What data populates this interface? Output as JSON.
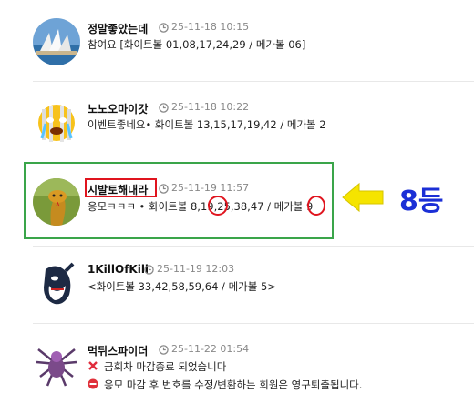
{
  "comments": [
    {
      "nick": "정말좋았는데",
      "time": "25-11-18 10:15",
      "text": "참여요 [화이트볼 01,08,17,24,29 / 메가볼 06]",
      "avatar": "opera-house-photo-avatar"
    },
    {
      "nick": "노노오마이갓",
      "time": "25-11-18 10:22",
      "text": "이벤트좋네요• 화이트볼 13,15,17,19,42 / 메가볼 2",
      "avatar": "crying-emoji-avatar"
    },
    {
      "nick": "시발토해내라",
      "time": "25-11-19 11:57",
      "text_prefix": "응모ㅋㅋㅋ • 화이트볼 8,",
      "circled_1": "19",
      "text_mid": ",25,38,47 / 메가볼 ",
      "circled_2": "9",
      "avatar": "cobra-snake-avatar"
    },
    {
      "nick": "1KillOfKill",
      "time": "25-11-19 12:03",
      "text": "<화이트볼 33,42,58,59,64 / 메가볼 5>",
      "avatar": "orca-character-avatar"
    },
    {
      "nick": "먹뒤스파이더",
      "time": "25-11-22 01:54",
      "line1": "금회차 마감종료 되었습니다",
      "line2": "응모 마감 후 번호를 수정/변환하는 회원은 영구퇴출됩니다.",
      "avatar": "spider-avatar"
    }
  ],
  "annotation": {
    "rank_label": "8등",
    "arrow_color": "#f5e400",
    "highlight_color": "#3aa54a",
    "mark_color": "#e0141e"
  },
  "icons": {
    "time": "clock-icon",
    "closed": "red-x-icon",
    "warning": "no-entry-icon"
  }
}
